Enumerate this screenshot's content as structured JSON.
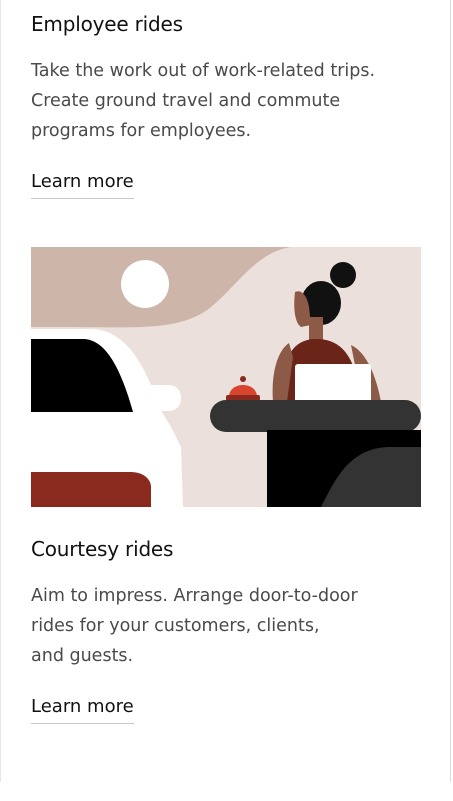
{
  "employee": {
    "title": "Employee rides",
    "description": "Take the work out of work-related trips.\nCreate ground travel and commute\nprograms for employees.",
    "link_label": "Learn more"
  },
  "courtesy": {
    "title": "Courtesy rides",
    "description": "Aim to impress. Arrange door-to-door\nrides for your customers, clients,\nand guests.",
    "link_label": "Learn more"
  },
  "illustration": {
    "colors": {
      "background": "#ebe0dc",
      "sky_shape": "#cdb5aa",
      "car_body": "#ffffff",
      "window": "#000000",
      "accent_red": "#8a2a1e",
      "bell": "#d8452f",
      "desk": "#333333",
      "skin": "#8c5a46",
      "top": "#6b2418"
    }
  }
}
